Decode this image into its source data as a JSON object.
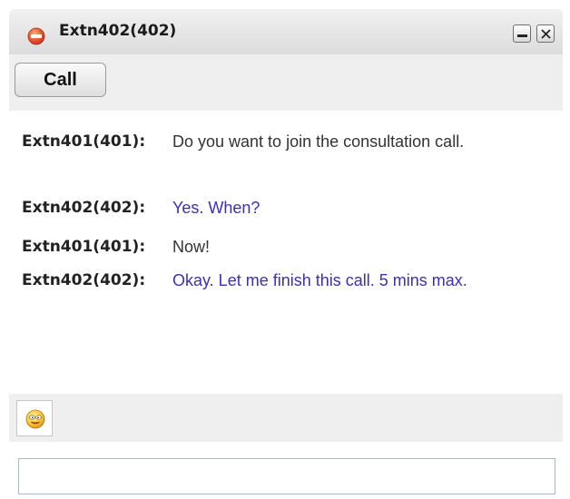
{
  "window": {
    "title": "Extn402(402)",
    "status_icon": "do-not-disturb-icon",
    "status_color": "#e8542a",
    "minimize_icon": "minimize-icon",
    "close_icon": "close-icon"
  },
  "toolbar": {
    "call_label": "Call"
  },
  "messages": [
    {
      "sender": "Extn401(401):",
      "text": "Do you want to join the consultation call.",
      "is_reply": false
    },
    {
      "sender": "Extn402(402):",
      "text": "Yes. When?",
      "is_reply": true
    },
    {
      "sender": "Extn401(401):",
      "text": "Now!",
      "is_reply": false
    },
    {
      "sender": "Extn402(402):",
      "text": "Okay. Let me finish this call. 5 mins max.",
      "is_reply": true
    }
  ],
  "colors": {
    "incoming_text": "#333333",
    "reply_text": "#3a2fbf"
  },
  "emoji": {
    "icon": "smiley-icon"
  },
  "input": {
    "value": "",
    "placeholder": ""
  }
}
